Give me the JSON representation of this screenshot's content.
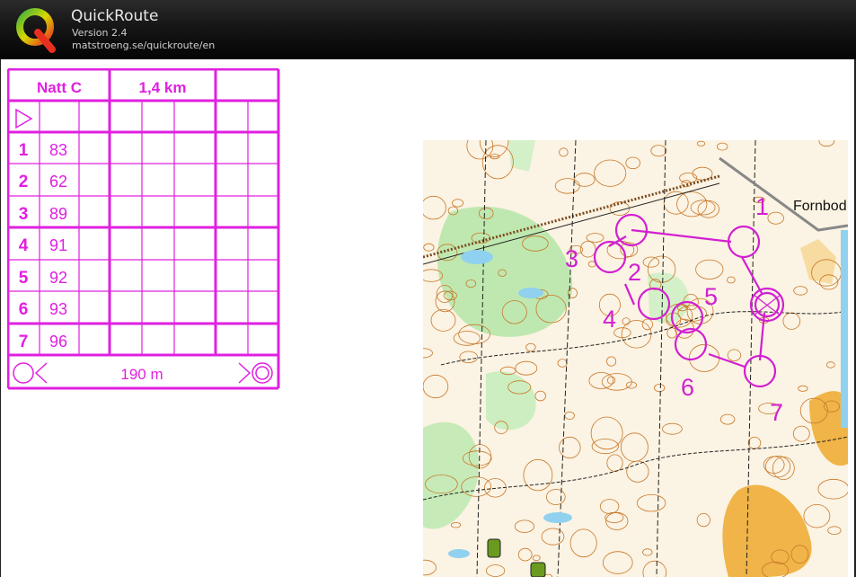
{
  "app": {
    "title": "QuickRoute",
    "version": "Version 2.4",
    "url": "matstroeng.se/quickroute/en"
  },
  "card": {
    "event": "Natt C",
    "length": "1,4 km",
    "controls": [
      {
        "num": "1",
        "code": "83"
      },
      {
        "num": "2",
        "code": "62"
      },
      {
        "num": "3",
        "code": "89"
      },
      {
        "num": "4",
        "code": "91"
      },
      {
        "num": "5",
        "code": "92"
      },
      {
        "num": "6",
        "code": "93"
      },
      {
        "num": "7",
        "code": "96"
      }
    ],
    "finish_distance": "190 m",
    "color": "#e020e0"
  },
  "map": {
    "place_label": "Fornbod",
    "control_labels": [
      "1",
      "2",
      "3",
      "4",
      "5",
      "6",
      "7"
    ],
    "overprint_color": "#d21fd2"
  }
}
